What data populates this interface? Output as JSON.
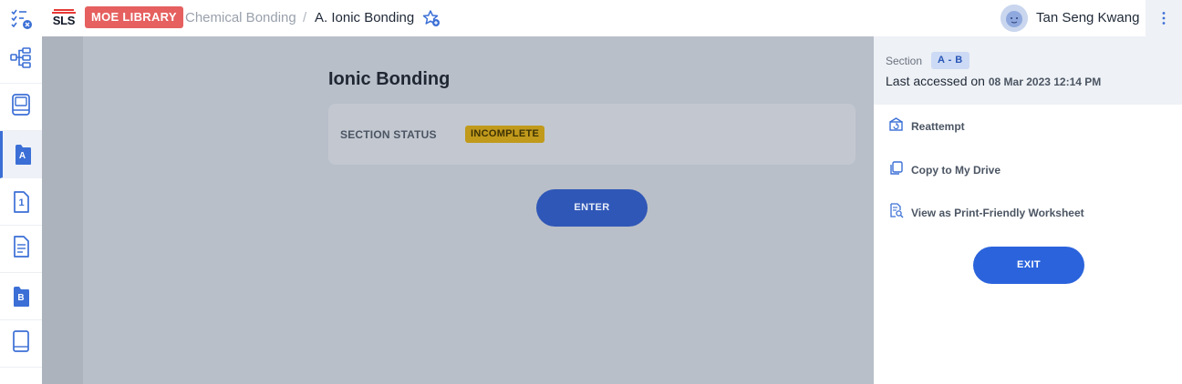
{
  "topbar": {
    "logo_text": "SLS",
    "library_badge": "MOE LIBRARY",
    "breadcrumb_parent": "Chemical Bonding",
    "breadcrumb_separator": "/",
    "breadcrumb_current": "A. Ionic Bonding",
    "user_name": "Tan Seng Kwang",
    "icons": [
      "menu-checklist-icon",
      "favourite-star-icon",
      "avatar",
      "more-vertical-icon"
    ]
  },
  "rail": {
    "items": [
      {
        "icon": "tree-structure-icon",
        "letter": ""
      },
      {
        "icon": "book-icon",
        "letter": ""
      },
      {
        "icon": "section-a-icon",
        "letter": "A"
      },
      {
        "icon": "page-1-icon",
        "letter": "1"
      },
      {
        "icon": "document-icon",
        "letter": ""
      },
      {
        "icon": "section-b-icon",
        "letter": "B"
      },
      {
        "icon": "book-end-icon",
        "letter": ""
      }
    ]
  },
  "main": {
    "title": "Ionic Bonding",
    "status_label": "SECTION STATUS",
    "status_value": "INCOMPLETE",
    "enter_label": "ENTER"
  },
  "panel": {
    "section_label": "Section",
    "section_value": "A - B",
    "last_accessed_label": "Last accessed on",
    "last_accessed_date": "08 Mar 2023 12:14 PM",
    "actions": [
      {
        "icon": "reattempt-icon",
        "label": "Reattempt"
      },
      {
        "icon": "copy-icon",
        "label": "Copy to My Drive"
      },
      {
        "icon": "print-preview-icon",
        "label": "View as Print-Friendly Worksheet"
      }
    ],
    "exit_label": "EXIT"
  },
  "colors": {
    "accent": "#2b63dc",
    "library_badge": "#e5605f",
    "status_badge": "#c19a1b",
    "overlay": "#b9bfc9"
  }
}
